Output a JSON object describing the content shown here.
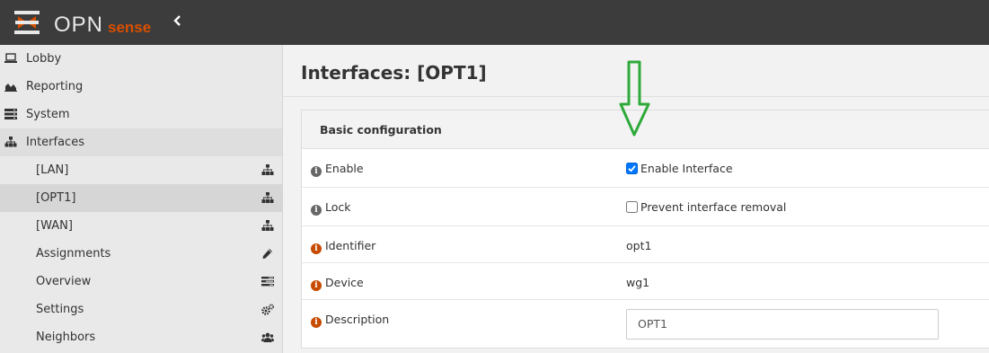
{
  "brand": {
    "name": "OPN",
    "suffix": "sense",
    "accent": "#d94f00"
  },
  "topbar": {
    "collapse_icon": "chevron-left-icon"
  },
  "sidebar": {
    "items": [
      {
        "label": "Lobby",
        "icon": "laptop-icon"
      },
      {
        "label": "Reporting",
        "icon": "area-chart-icon"
      },
      {
        "label": "System",
        "icon": "server-icon"
      },
      {
        "label": "Interfaces",
        "icon": "sitemap-icon"
      }
    ],
    "interfaces_sub": [
      {
        "label": "[LAN]",
        "icon": "sitemap-icon"
      },
      {
        "label": "[OPT1]",
        "icon": "sitemap-icon",
        "selected": true
      },
      {
        "label": "[WAN]",
        "icon": "sitemap-icon"
      },
      {
        "label": "Assignments",
        "icon": "pencil-icon"
      },
      {
        "label": "Overview",
        "icon": "tasks-icon"
      },
      {
        "label": "Settings",
        "icon": "cogs-icon"
      },
      {
        "label": "Neighbors",
        "icon": "users-icon"
      }
    ]
  },
  "page": {
    "title": "Interfaces: [OPT1]"
  },
  "panel": {
    "title": "Basic configuration",
    "rows": [
      {
        "label": "Enable",
        "info_color": "grey",
        "checkbox_label": "Enable Interface",
        "checked": true
      },
      {
        "label": "Lock",
        "info_color": "grey",
        "checkbox_label": "Prevent interface removal",
        "checked": false
      },
      {
        "label": "Identifier",
        "info_color": "orange",
        "value": "opt1"
      },
      {
        "label": "Device",
        "info_color": "orange",
        "value": "wg1"
      },
      {
        "label": "Description",
        "info_color": "orange",
        "input_value": "OPT1"
      }
    ]
  },
  "annotation": {
    "icon": "down-arrow-icon",
    "color": "#2eaa3a"
  }
}
